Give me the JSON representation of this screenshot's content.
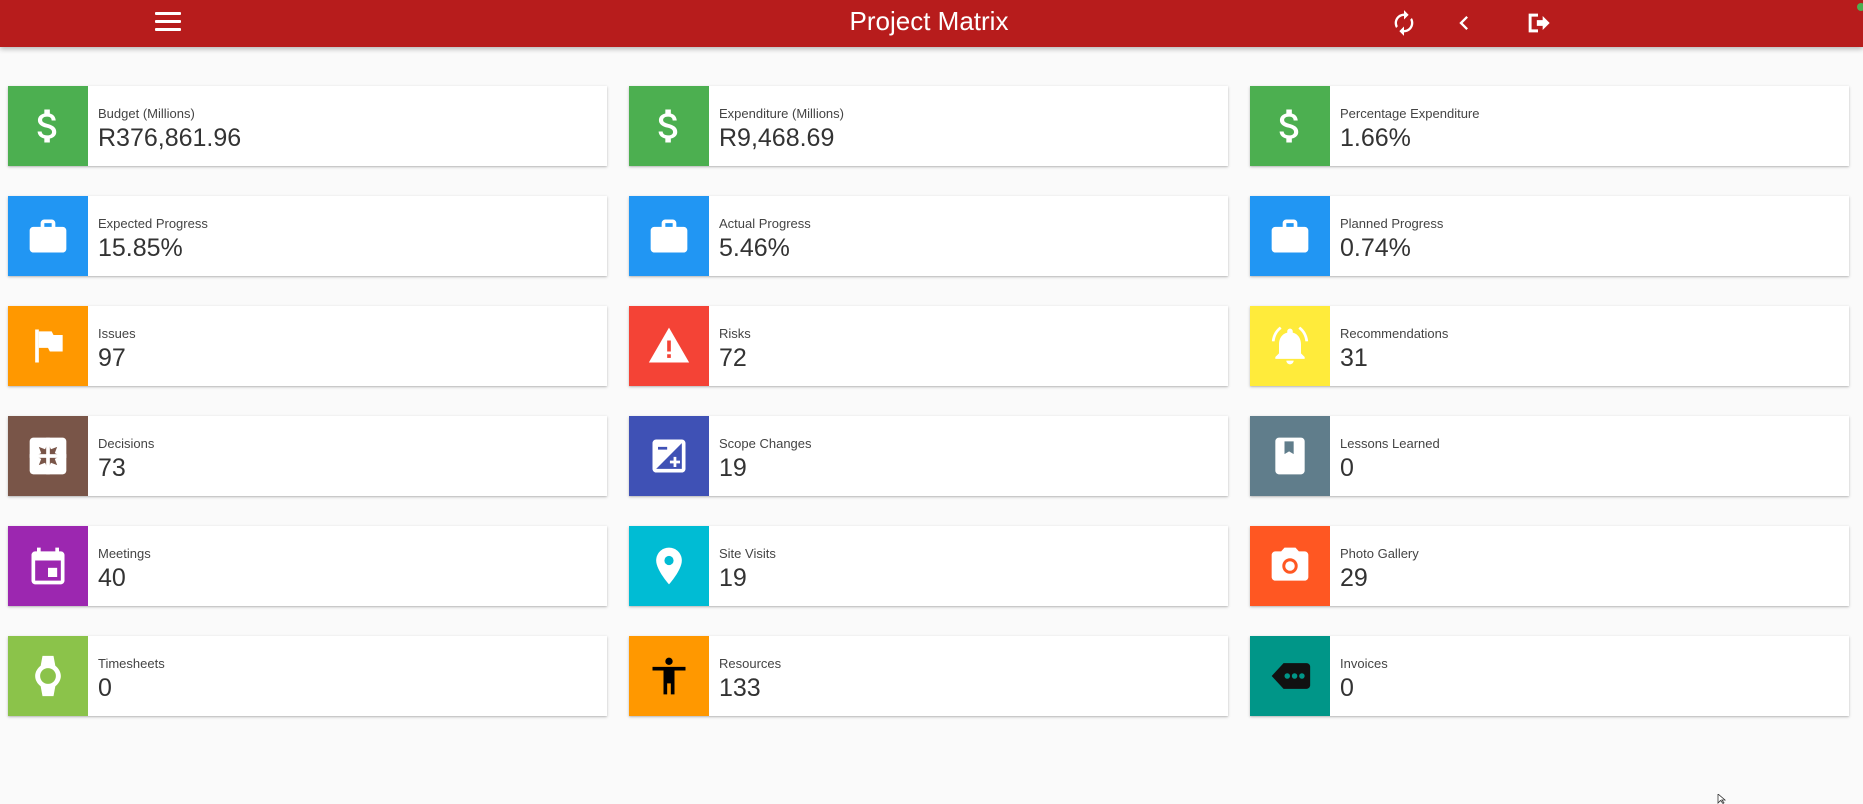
{
  "header": {
    "title": "Project Matrix",
    "menu_icon": "menu-icon",
    "actions": [
      "refresh-icon",
      "back-icon",
      "logout-icon"
    ]
  },
  "tiles": [
    {
      "label": "Budget (Millions)",
      "value": "R376,861.96",
      "icon": "dollar-icon",
      "color": "#4caf50"
    },
    {
      "label": "Expenditure (Millions)",
      "value": "R9,468.69",
      "icon": "dollar-icon",
      "color": "#4caf50"
    },
    {
      "label": "Percentage Expenditure",
      "value": "1.66%",
      "icon": "dollar-icon",
      "color": "#4caf50"
    },
    {
      "label": "Expected Progress",
      "value": "15.85%",
      "icon": "briefcase-icon",
      "color": "#2196f3"
    },
    {
      "label": "Actual Progress",
      "value": "5.46%",
      "icon": "briefcase-icon",
      "color": "#2196f3"
    },
    {
      "label": "Planned Progress",
      "value": "0.74%",
      "icon": "briefcase-icon",
      "color": "#2196f3"
    },
    {
      "label": "Issues",
      "value": "97",
      "icon": "flag-icon",
      "color": "#ff9800"
    },
    {
      "label": "Risks",
      "value": "72",
      "icon": "warning-icon",
      "color": "#f44336"
    },
    {
      "label": "Recommendations",
      "value": "31",
      "icon": "bell-icon",
      "color": "#ffeb3b"
    },
    {
      "label": "Decisions",
      "value": "73",
      "icon": "decision-icon",
      "color": "#795548"
    },
    {
      "label": "Scope Changes",
      "value": "19",
      "icon": "exposure-icon",
      "color": "#3f51b5"
    },
    {
      "label": "Lessons Learned",
      "value": "0",
      "icon": "bookmark-icon",
      "color": "#607d8b"
    },
    {
      "label": "Meetings",
      "value": "40",
      "icon": "calendar-icon",
      "color": "#9c27b0"
    },
    {
      "label": "Site Visits",
      "value": "19",
      "icon": "map-pin-icon",
      "color": "#00bcd4"
    },
    {
      "label": "Photo Gallery",
      "value": "29",
      "icon": "camera-icon",
      "color": "#ff5722"
    },
    {
      "label": "Timesheets",
      "value": "0",
      "icon": "watch-icon",
      "color": "#8bc34a"
    },
    {
      "label": "Resources",
      "value": "133",
      "icon": "accessibility-icon",
      "color": "#ff9800"
    },
    {
      "label": "Invoices",
      "value": "0",
      "icon": "tag-icon",
      "color": "#009688"
    }
  ]
}
